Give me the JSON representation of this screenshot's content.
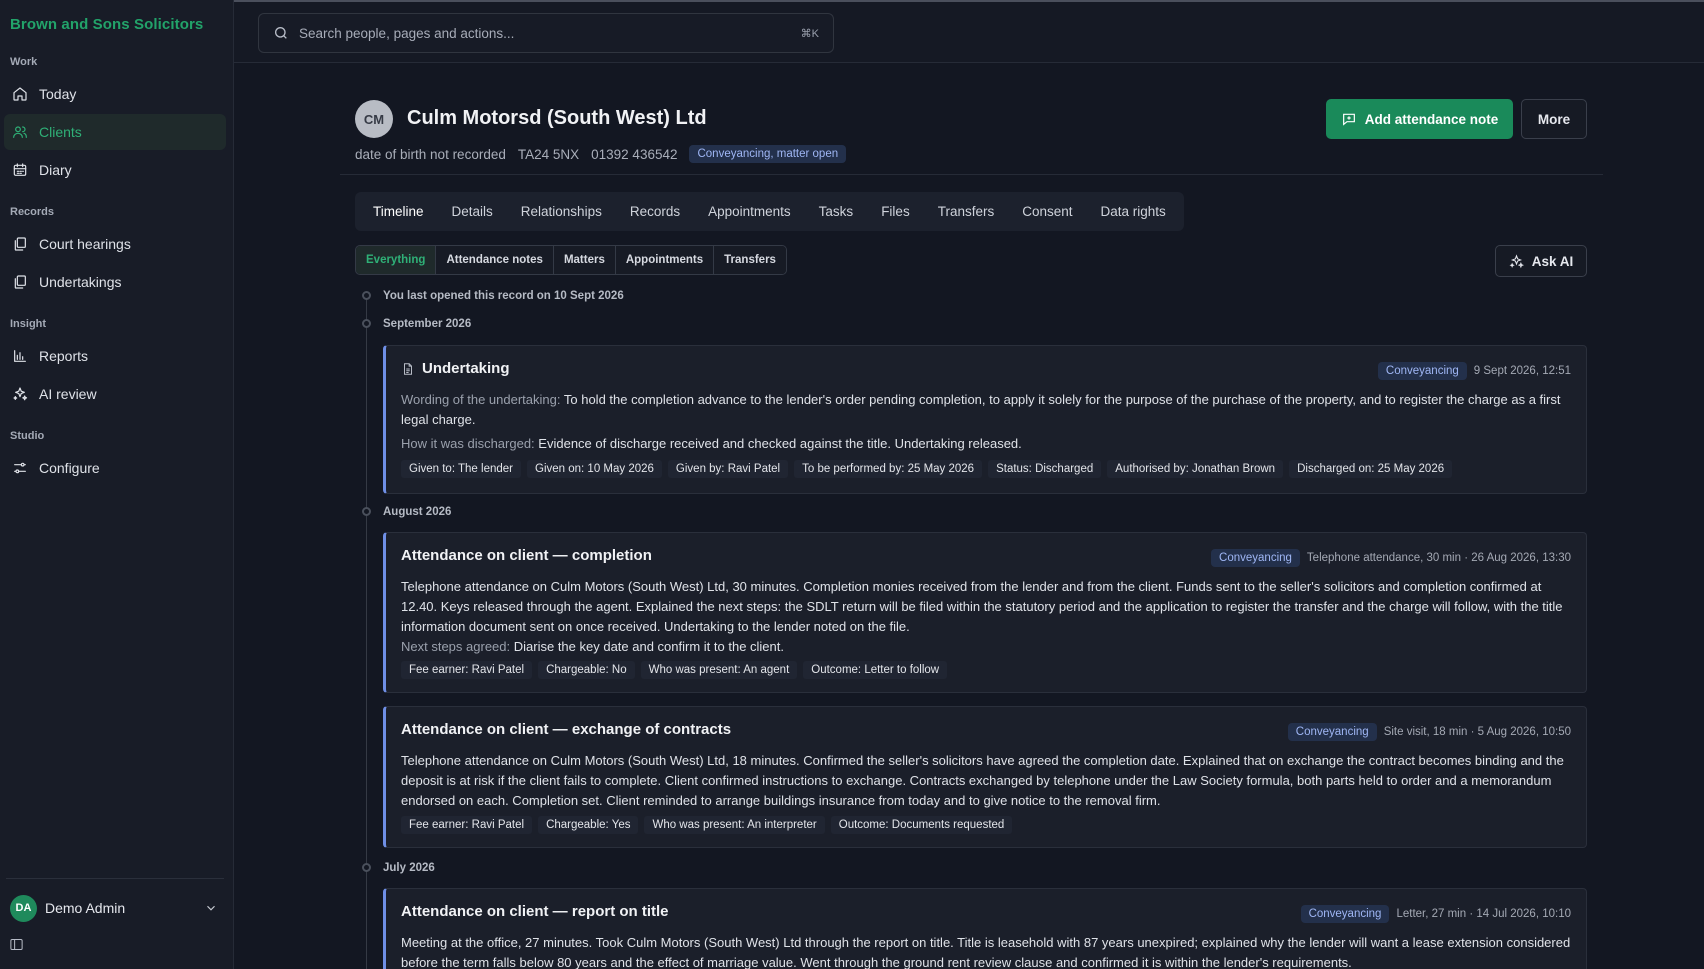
{
  "sidebar": {
    "brand": "Brown and Sons Solicitors",
    "sections": {
      "work": "Work",
      "records": "Records",
      "insight": "Insight",
      "studio": "Studio"
    },
    "items": {
      "today": "Today",
      "clients": "Clients",
      "diary": "Diary",
      "court_hearings": "Court hearings",
      "undertakings": "Undertakings",
      "reports": "Reports",
      "ai_review": "AI review",
      "configure": "Configure"
    },
    "user": {
      "initials": "DA",
      "name": "Demo Admin"
    }
  },
  "search": {
    "placeholder": "Search people, pages and actions...",
    "shortcut": "⌘K"
  },
  "client": {
    "initials": "CM",
    "name": "Culm Motorsd (South West) Ltd",
    "dob": "date of birth not recorded",
    "postcode": "TA24 5NX",
    "phone": "01392 436542",
    "status_badge": "Conveyancing, matter open"
  },
  "actions": {
    "add_note": "Add attendance note",
    "more": "More",
    "ask_ai": "Ask AI"
  },
  "tabs": [
    "Timeline",
    "Details",
    "Relationships",
    "Records",
    "Appointments",
    "Tasks",
    "Files",
    "Transfers",
    "Consent",
    "Data rights"
  ],
  "filters": [
    "Everything",
    "Attendance notes",
    "Matters",
    "Appointments",
    "Transfers"
  ],
  "timeline": {
    "last_opened": "You last opened this record on 10 Sept 2026",
    "months": [
      "September 2026",
      "August 2026",
      "July 2026"
    ],
    "undertaking": {
      "title": "Undertaking",
      "badge": "Conveyancing",
      "meta": "9 Sept 2026, 12:51",
      "wording_label": "Wording of the undertaking:",
      "wording": "To hold the completion advance to the lender's order pending completion, to apply it solely for the purpose of the purchase of the property, and to register the charge as a first legal charge.",
      "discharge_label": "How it was discharged:",
      "discharge": "Evidence of discharge received and checked against the title. Undertaking released.",
      "chips": [
        "Given to: The lender",
        "Given on: 10 May 2026",
        "Given by: Ravi Patel",
        "To be performed by: 25 May 2026",
        "Status: Discharged",
        "Authorised by: Jonathan Brown",
        "Discharged on: 25 May 2026"
      ]
    },
    "completion": {
      "title": "Attendance on client — completion",
      "badge": "Conveyancing",
      "meta": "Telephone attendance, 30 min · 26 Aug 2026, 13:30",
      "body": "Telephone attendance on Culm Motors (South West) Ltd, 30 minutes. Completion monies received from the lender and from the client. Funds sent to the seller's solicitors and completion confirmed at 12.40. Keys released through the agent. Explained the next steps: the SDLT return will be filed within the statutory period and the application to register the transfer and the charge will follow, with the title information document sent on once received. Undertaking to the lender noted on the file.",
      "next_label": "Next steps agreed:",
      "next": "Diarise the key date and confirm it to the client.",
      "chips": [
        "Fee earner: Ravi Patel",
        "Chargeable: No",
        "Who was present: An agent",
        "Outcome: Letter to follow"
      ]
    },
    "exchange": {
      "title": "Attendance on client — exchange of contracts",
      "badge": "Conveyancing",
      "meta": "Site visit, 18 min · 5 Aug 2026, 10:50",
      "body": "Telephone attendance on Culm Motors (South West) Ltd, 18 minutes. Confirmed the seller's solicitors have agreed the completion date. Explained that on exchange the contract becomes binding and the deposit is at risk if the client fails to complete. Client confirmed instructions to exchange. Contracts exchanged by telephone under the Law Society formula, both parts held to order and a memorandum endorsed on each. Completion set. Client reminded to arrange buildings insurance from today and to give notice to the removal firm.",
      "chips": [
        "Fee earner: Ravi Patel",
        "Chargeable: Yes",
        "Who was present: An interpreter",
        "Outcome: Documents requested"
      ]
    },
    "report": {
      "title": "Attendance on client — report on title",
      "badge": "Conveyancing",
      "meta": "Letter, 27 min · 14 Jul 2026, 10:10",
      "body": "Meeting at the office, 27 minutes. Took Culm Motors (South West) Ltd through the report on title. Title is leasehold with 87 years unexpired; explained why the lender will want a lease extension considered before the term falls below 80 years and the effect of marriage value. Went through the ground rent review clause and confirmed it is within the lender's requirements."
    }
  },
  "colors": {
    "accent_green": "#1a8a5a",
    "brand_green": "#22a36a",
    "card_border_blue": "#6f8fe6",
    "badge_bg": "#23304b"
  }
}
